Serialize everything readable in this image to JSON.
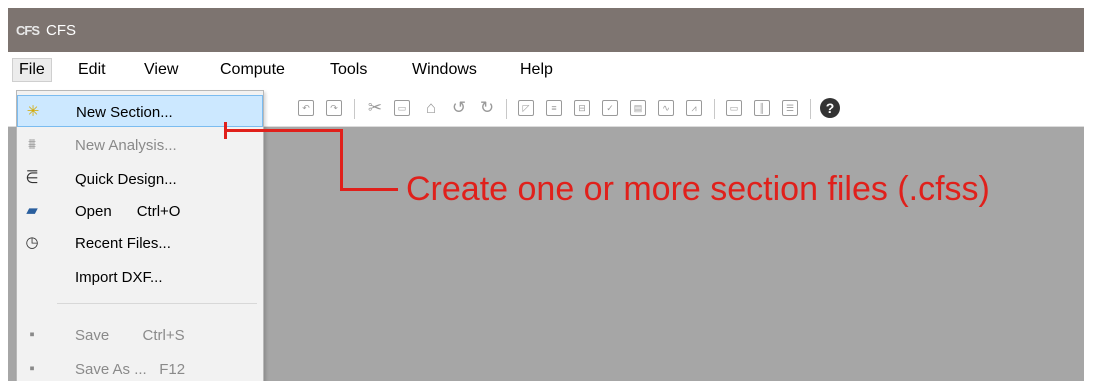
{
  "window": {
    "app_icon": "CFS",
    "title": "CFS"
  },
  "menubar": {
    "items": [
      "File",
      "Edit",
      "View",
      "Compute",
      "Tools",
      "Windows",
      "Help"
    ]
  },
  "toolbar": {
    "icons": [
      "undo-icon",
      "redo-icon",
      "cut-icon",
      "copy-icon",
      "paste-icon",
      "rotate-left-icon",
      "rotate-right-icon",
      "section-properties-icon",
      "edit-section-icon",
      "element-icon",
      "check-icon",
      "report-icon",
      "graph-icon",
      "graph-alt-icon",
      "window-icon",
      "columns-icon",
      "rows-icon",
      "help-icon"
    ],
    "help_glyph": "?"
  },
  "file_menu": {
    "items": [
      {
        "label": "New Section...",
        "icon": "new-section-icon",
        "enabled": true,
        "highlighted": true
      },
      {
        "label": "New Analysis...",
        "icon": "new-analysis-icon",
        "enabled": false
      },
      {
        "label": "Quick Design...",
        "icon": "quick-design-icon",
        "enabled": true
      },
      {
        "label": "Open      Ctrl+O",
        "icon": "open-folder-icon",
        "enabled": true
      },
      {
        "label": "Recent Files...",
        "icon": "recent-files-icon",
        "enabled": true
      },
      {
        "label": "Import DXF...",
        "icon": "",
        "enabled": true
      },
      {
        "label": "Save        Ctrl+S",
        "icon": "save-icon",
        "enabled": false
      },
      {
        "label": "Save As ...   F12",
        "icon": "save-as-icon",
        "enabled": false
      }
    ]
  },
  "annotation": {
    "text": "Create one or more section files (.cfss)",
    "color": "#e0201b"
  },
  "colors": {
    "titlebar": "#7d7470",
    "workspace": "#a6a6a6",
    "menu_highlight": "#cce8ff"
  }
}
